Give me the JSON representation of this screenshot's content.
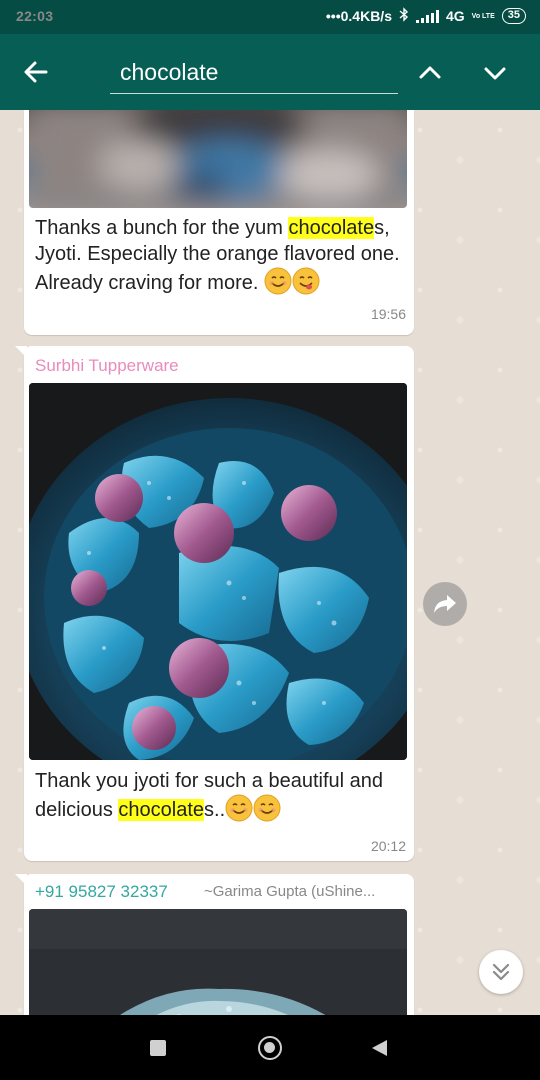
{
  "status_bar": {
    "time": "22:03",
    "network_speed": "0.4KB/s",
    "network_type": "4G",
    "volte": "Vo LTE",
    "battery": "35"
  },
  "search": {
    "value": "chocolate"
  },
  "messages": [
    {
      "text_parts": [
        "Thanks a bunch for the yum ",
        "chocolate",
        "s, Jyoti. Especially the orange flavored one. Already craving for more. "
      ],
      "time": "19:56"
    },
    {
      "sender": "Surbhi Tupperware",
      "text_parts": [
        "Thank you jyoti for such a beautiful and delicious ",
        "chocolate",
        "s.."
      ],
      "time": "20:12"
    },
    {
      "sender": "+91 95827 32337",
      "sender_alias": "~Garima Gupta (uShine..."
    }
  ],
  "colors": {
    "header": "#075e54",
    "status_bar": "#054d44",
    "highlight": "#ffff1a",
    "sender_1": "#e88bbd",
    "sender_2": "#35a7a1"
  },
  "icons": {
    "back": "arrow-left-icon",
    "prev": "chevron-up-icon",
    "next": "chevron-down-icon",
    "forward": "forward-icon",
    "scroll_down": "double-chevron-down-icon",
    "emoji": "smiling-face-emoji"
  }
}
